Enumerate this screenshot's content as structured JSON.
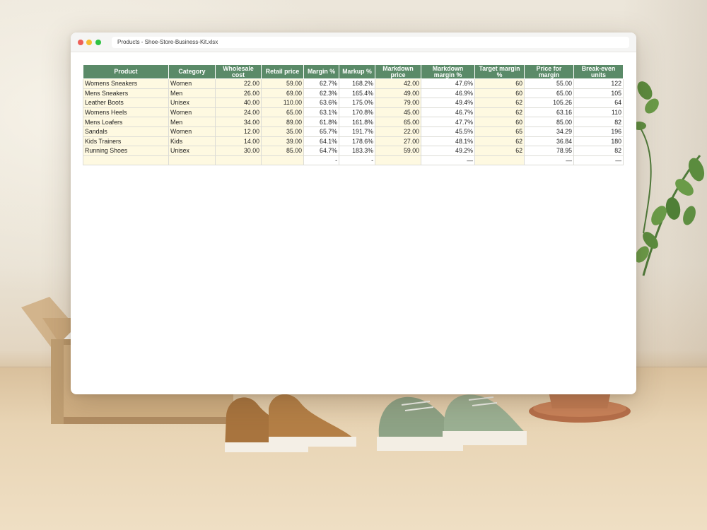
{
  "window": {
    "title": "Products - Shoe-Store-Business-Kit.xlsx"
  },
  "colors": {
    "header_bg": "#5a8a68",
    "input_bg": "#fef9e1",
    "input_text": "#1f3d8a"
  },
  "icons": [
    "close-dot-icon",
    "minimize-dot-icon",
    "maximize-dot-icon"
  ],
  "table": {
    "headers": [
      "Product",
      "Category",
      "Wholesale cost",
      "Retail price",
      "Margin %",
      "Markup %",
      "Markdown price",
      "Markdown margin %",
      "Target margin %",
      "Price for margin",
      "Break-even units"
    ],
    "rows": [
      [
        "Womens Sneakers",
        "Women",
        "22.00",
        "59.00",
        "62.7%",
        "168.2%",
        "42.00",
        "47.6%",
        "60",
        "55.00",
        "122"
      ],
      [
        "Mens Sneakers",
        "Men",
        "26.00",
        "69.00",
        "62.3%",
        "165.4%",
        "49.00",
        "46.9%",
        "60",
        "65.00",
        "105"
      ],
      [
        "Leather Boots",
        "Unisex",
        "40.00",
        "110.00",
        "63.6%",
        "175.0%",
        "79.00",
        "49.4%",
        "62",
        "105.26",
        "64"
      ],
      [
        "Womens Heels",
        "Women",
        "24.00",
        "65.00",
        "63.1%",
        "170.8%",
        "45.00",
        "46.7%",
        "62",
        "63.16",
        "110"
      ],
      [
        "Mens Loafers",
        "Men",
        "34.00",
        "89.00",
        "61.8%",
        "161.8%",
        "65.00",
        "47.7%",
        "60",
        "85.00",
        "82"
      ],
      [
        "Sandals",
        "Women",
        "12.00",
        "35.00",
        "65.7%",
        "191.7%",
        "22.00",
        "45.5%",
        "65",
        "34.29",
        "196"
      ],
      [
        "Kids Trainers",
        "Kids",
        "14.00",
        "39.00",
        "64.1%",
        "178.6%",
        "27.00",
        "48.1%",
        "62",
        "36.84",
        "180"
      ],
      [
        "Running Shoes",
        "Unisex",
        "30.00",
        "85.00",
        "64.7%",
        "183.3%",
        "59.00",
        "49.2%",
        "62",
        "78.95",
        "82"
      ],
      [
        "",
        "",
        "",
        "",
        "-",
        "-",
        "",
        "—",
        "",
        "—",
        "—"
      ]
    ]
  }
}
